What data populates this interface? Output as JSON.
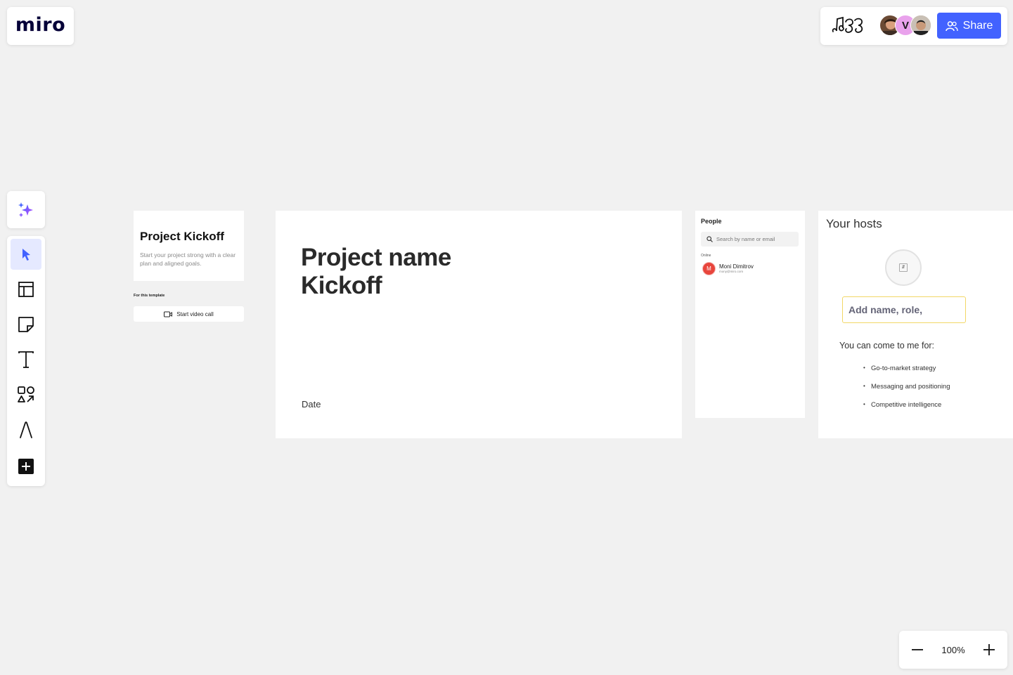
{
  "app": {
    "logo_text": "miro"
  },
  "header": {
    "share_label": "Share",
    "collaborators": [
      {
        "initial": "",
        "color": "#6b4a34"
      },
      {
        "initial": "V",
        "color": "#e9a2ec"
      },
      {
        "initial": "",
        "color": "#b9a999"
      }
    ]
  },
  "toolbar": {
    "accent": "#4262ff",
    "items": [
      {
        "name": "ai-assist",
        "icon": "sparkle-icon"
      },
      {
        "name": "select",
        "icon": "cursor-icon",
        "active": true
      },
      {
        "name": "templates",
        "icon": "layout-icon"
      },
      {
        "name": "sticky-note",
        "icon": "sticky-note-icon"
      },
      {
        "name": "text",
        "icon": "text-icon"
      },
      {
        "name": "shapes",
        "icon": "shapes-icon"
      },
      {
        "name": "pen",
        "icon": "pen-icon"
      },
      {
        "name": "more",
        "icon": "plus-square-icon"
      }
    ]
  },
  "board": {
    "intro": {
      "title": "Project Kickoff",
      "subtitle": "Start your project strong with a clear plan and aligned goals.",
      "for_template": "For this template",
      "video_call_label": "Start video call"
    },
    "main_frame": {
      "title_line1": "Project name",
      "title_line2": "Kickoff",
      "date_label": "Date"
    },
    "people": {
      "title": "People",
      "search_placeholder": "Search by name or email",
      "online_label": "Online",
      "person": {
        "initial": "M",
        "name": "Moni Dimitrov",
        "email": "mony@miro.com"
      }
    },
    "hosts": {
      "title": "Your hosts",
      "name_placeholder": "Add name, role,",
      "come_to_me": "You can come to me for:",
      "topics": [
        "Go-to-market strategy",
        "Messaging and positioning",
        "Competitive intelligence"
      ]
    }
  },
  "zoom": {
    "level": "100%"
  }
}
